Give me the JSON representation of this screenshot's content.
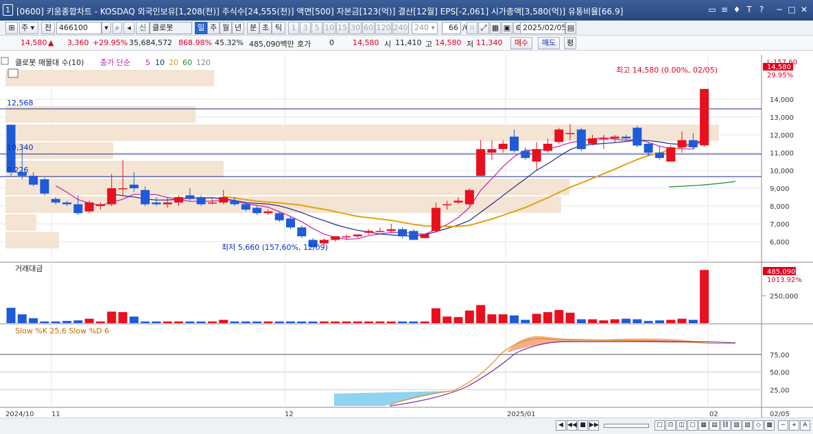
{
  "title": {
    "num": "1",
    "text": "[0600] 키움종합차트 - KOSDAQ 외국인보유[1,208(천)] 주식수[24,555(천)] 액면[500] 자본금[123(억)] 결산[12월] EPS[-2,061] 시가총액[3,580(억)] 유통비율[66.9]"
  },
  "toolbar": {
    "market": "주",
    "prefix": "전",
    "code": "466100",
    "name_tag": "신",
    "name": "클로봇",
    "periods": [
      "일",
      "주",
      "월",
      "년",
      "분",
      "초",
      "틱"
    ],
    "intervals": [
      "1",
      "3",
      "5",
      "10",
      "15",
      "30",
      "60",
      "120",
      "240"
    ],
    "interval_sel": "240",
    "count": "66",
    "count_total": "/66",
    "date": "2025/02/05"
  },
  "quote": {
    "price": "14,580",
    "arrow": "▲",
    "change": "3,360",
    "rate": "+29.95%",
    "volume": "35,684,572",
    "vol_rate": "868.98%",
    "turnover": "45.32%",
    "amount": "485,090백만",
    "ask_label": "호가",
    "ask": "0",
    "bid": "14,580",
    "open_label": "시",
    "open": "11,410",
    "high_label": "고",
    "high": "14,580",
    "low_label": "저",
    "low": "11,340",
    "buy": "매수",
    "sell": "매도",
    "eval": "평"
  },
  "legend": {
    "main": "클로봇 매물대 수(10)",
    "ma_label": "종가 단순",
    "ma5": "5",
    "ma10": "10",
    "ma20": "20",
    "ma60": "60",
    "ma120": "120",
    "vol": "거래대금",
    "stoch": "Slow %K 25,6   Slow %D 6"
  },
  "annotations": {
    "high": "최고 14,580 (0.00%, 02/05)",
    "low": "최저 5,660 (157,60%, 12/09)",
    "h1": "12,568",
    "h2": "10,340",
    "h3": "9,226",
    "top": "L:157.60",
    "price": "14,580",
    "pct": "29.95%",
    "vol": "485,090",
    "volpct": "1013.92%"
  },
  "axis": {
    "price": [
      "14,000",
      "13,000",
      "12,000",
      "11,000",
      "10,000",
      "9,000",
      "8,000",
      "7,000",
      "6,000"
    ],
    "vol": [
      "250,000"
    ],
    "stoch": [
      "75,00",
      "50,00",
      "25,00"
    ],
    "dates": [
      "2024/10",
      "11",
      "12",
      "2025/01",
      "02",
      "02/05"
    ]
  },
  "colors": {
    "up": "#e8101e",
    "down": "#1d5bd8",
    "ma5": "#c21bb0",
    "ma10": "#1a2a8a",
    "ma20": "#e1a10e",
    "ma60": "#1a8a3a",
    "vp": "#f3e4d3"
  },
  "chart_data": [
    {
      "type": "candlestick",
      "title": "클로봇 매물대 수(10)",
      "ylim": [
        5400,
        15300
      ],
      "series": [
        {
          "o": 12568,
          "h": 12568,
          "c": 9900,
          "l": 9700
        },
        {
          "o": 9900,
          "h": 11300,
          "c": 9700,
          "l": 9500
        },
        {
          "o": 9700,
          "h": 9900,
          "c": 9200,
          "l": 9100
        },
        {
          "o": 9500,
          "h": 9600,
          "c": 8700,
          "l": 8600
        },
        {
          "o": 8400,
          "h": 8500,
          "c": 8200,
          "l": 8100
        },
        {
          "o": 8200,
          "h": 8300,
          "c": 8100,
          "l": 8000
        },
        {
          "o": 8100,
          "h": 8600,
          "c": 7600,
          "l": 7500
        },
        {
          "o": 7700,
          "h": 8300,
          "c": 8200,
          "l": 7600
        },
        {
          "o": 8000,
          "h": 8200,
          "c": 8100,
          "l": 7800
        },
        {
          "o": 8100,
          "h": 9800,
          "c": 9000,
          "l": 8000
        },
        {
          "o": 9000,
          "h": 10600,
          "c": 9000,
          "l": 8600
        },
        {
          "o": 9200,
          "h": 9900,
          "c": 9000,
          "l": 8800
        },
        {
          "o": 8900,
          "h": 9100,
          "c": 8100,
          "l": 8000
        },
        {
          "o": 8200,
          "h": 8500,
          "c": 8100,
          "l": 8000
        },
        {
          "o": 8100,
          "h": 8500,
          "c": 8200,
          "l": 7900
        },
        {
          "o": 8200,
          "h": 8600,
          "c": 8500,
          "l": 8000
        },
        {
          "o": 8600,
          "h": 9000,
          "c": 8400,
          "l": 8300
        },
        {
          "o": 8500,
          "h": 8600,
          "c": 8100,
          "l": 8000
        },
        {
          "o": 8200,
          "h": 8400,
          "c": 8200,
          "l": 8100
        },
        {
          "o": 8200,
          "h": 8900,
          "c": 8500,
          "l": 8100
        },
        {
          "o": 8300,
          "h": 8500,
          "c": 8100,
          "l": 8000
        },
        {
          "o": 8100,
          "h": 8200,
          "c": 7800,
          "l": 7700
        },
        {
          "o": 7900,
          "h": 8000,
          "c": 7600,
          "l": 7500
        },
        {
          "o": 7600,
          "h": 7800,
          "c": 7700,
          "l": 7500
        },
        {
          "o": 7600,
          "h": 7700,
          "c": 7200,
          "l": 7100
        },
        {
          "o": 7300,
          "h": 7400,
          "c": 6800,
          "l": 6700
        },
        {
          "o": 6800,
          "h": 6900,
          "c": 6300,
          "l": 6200
        },
        {
          "o": 6100,
          "h": 6200,
          "c": 5700,
          "l": 5660
        },
        {
          "o": 5900,
          "h": 6200,
          "c": 6100,
          "l": 5800
        },
        {
          "o": 6100,
          "h": 6300,
          "c": 6300,
          "l": 6000
        },
        {
          "o": 6300,
          "h": 6400,
          "c": 6300,
          "l": 6100
        },
        {
          "o": 6300,
          "h": 6400,
          "c": 6400,
          "l": 6200
        },
        {
          "o": 6500,
          "h": 6700,
          "c": 6600,
          "l": 6400
        },
        {
          "o": 6600,
          "h": 6800,
          "c": 6600,
          "l": 6500
        },
        {
          "o": 6600,
          "h": 7000,
          "c": 6700,
          "l": 6500
        },
        {
          "o": 6700,
          "h": 6800,
          "c": 6300,
          "l": 6200
        },
        {
          "o": 6600,
          "h": 6700,
          "c": 6100,
          "l": 6100
        },
        {
          "o": 6200,
          "h": 6400,
          "c": 6400,
          "l": 6200
        },
        {
          "o": 6600,
          "h": 8200,
          "c": 7900,
          "l": 6500
        },
        {
          "o": 8100,
          "h": 8300,
          "c": 8100,
          "l": 7800
        },
        {
          "o": 8200,
          "h": 8500,
          "c": 8300,
          "l": 8100
        },
        {
          "o": 8100,
          "h": 9000,
          "c": 8900,
          "l": 8000
        },
        {
          "o": 9700,
          "h": 11700,
          "c": 11200,
          "l": 9700
        },
        {
          "o": 11000,
          "h": 11700,
          "c": 11200,
          "l": 10600
        },
        {
          "o": 11200,
          "h": 11700,
          "c": 11500,
          "l": 11000
        },
        {
          "o": 11900,
          "h": 12300,
          "c": 11100,
          "l": 11000
        },
        {
          "o": 11100,
          "h": 11300,
          "c": 10700,
          "l": 10600
        },
        {
          "o": 10500,
          "h": 11600,
          "c": 11200,
          "l": 10000
        },
        {
          "o": 11100,
          "h": 11800,
          "c": 11500,
          "l": 11000
        },
        {
          "o": 11600,
          "h": 12400,
          "c": 12300,
          "l": 11500
        },
        {
          "o": 12100,
          "h": 12600,
          "c": 12100,
          "l": 11700
        },
        {
          "o": 12300,
          "h": 12400,
          "c": 11200,
          "l": 11100
        },
        {
          "o": 11500,
          "h": 12000,
          "c": 11800,
          "l": 11400
        },
        {
          "o": 11800,
          "h": 12000,
          "c": 11800,
          "l": 11200
        },
        {
          "o": 11800,
          "h": 12000,
          "c": 11900,
          "l": 11600
        },
        {
          "o": 11900,
          "h": 12000,
          "c": 11800,
          "l": 11700
        },
        {
          "o": 12400,
          "h": 12500,
          "c": 11400,
          "l": 11300
        },
        {
          "o": 11500,
          "h": 11600,
          "c": 11000,
          "l": 10800
        },
        {
          "o": 11000,
          "h": 11400,
          "c": 10700,
          "l": 10600
        },
        {
          "o": 10500,
          "h": 11400,
          "c": 11300,
          "l": 10500
        },
        {
          "o": 11300,
          "h": 12200,
          "c": 11700,
          "l": 11000
        },
        {
          "o": 11700,
          "h": 12100,
          "c": 11300,
          "l": 11200
        },
        {
          "o": 11410,
          "h": 14580,
          "c": 14580,
          "l": 11340
        }
      ]
    },
    {
      "type": "bar",
      "title": "거래대금",
      "ylim": [
        0,
        500000
      ],
      "values": [
        140000,
        80000,
        45000,
        15000,
        15000,
        20000,
        25000,
        40000,
        15000,
        105000,
        100000,
        60000,
        15000,
        15000,
        15000,
        15000,
        15000,
        15000,
        15000,
        30000,
        15000,
        15000,
        15000,
        15000,
        15000,
        15000,
        15000,
        15000,
        15000,
        15000,
        15000,
        15000,
        15000,
        15000,
        15000,
        15000,
        15000,
        15000,
        135000,
        60000,
        55000,
        115000,
        165000,
        80000,
        80000,
        70000,
        30000,
        85000,
        100000,
        120000,
        95000,
        35000,
        35000,
        25000,
        35000,
        40000,
        35000,
        20000,
        25000,
        30000,
        40000,
        30000,
        485090
      ]
    },
    {
      "type": "line",
      "title": "Slow %K 25,6   Slow %D 6",
      "ylim": [
        0,
        100
      ]
    }
  ]
}
